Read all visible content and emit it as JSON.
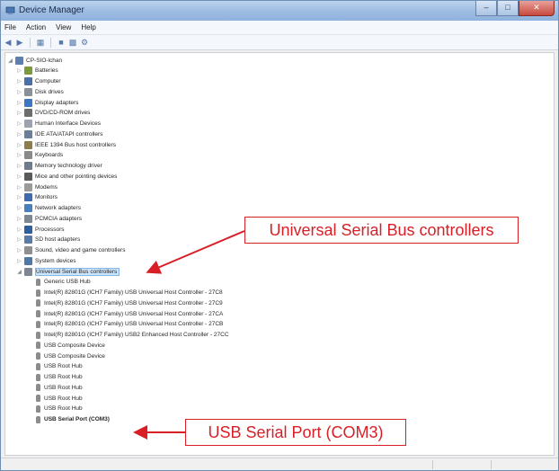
{
  "window": {
    "title": "Device Manager"
  },
  "menu": [
    "File",
    "Action",
    "View",
    "Help"
  ],
  "toolbar_icons": [
    "back-icon",
    "forward-icon",
    "properties-icon",
    "help-icon",
    "update-driver-icon",
    "scan-hardware-icon"
  ],
  "tree": {
    "root": "CP-SIO-lchan",
    "categories": [
      "Batteries",
      "Computer",
      "Disk drives",
      "Display adapters",
      "DVD/CD-ROM drives",
      "Human Interface Devices",
      "IDE ATA/ATAPI controllers",
      "IEEE 1394 Bus host controllers",
      "Keyboards",
      "Memory technology driver",
      "Mice and other pointing devices",
      "Modems",
      "Monitors",
      "Network adapters",
      "PCMCIA adapters",
      "Processors",
      "SD host adapters",
      "Sound, video and game controllers",
      "System devices"
    ],
    "expanded_category": "Universal Serial Bus controllers",
    "usb_children": [
      "Generic USB Hub",
      "Intel(R) 82801G (ICH7 Family) USB Universal Host Controller - 27C8",
      "Intel(R) 82801G (ICH7 Family) USB Universal Host Controller - 27C9",
      "Intel(R) 82801G (ICH7 Family) USB Universal Host Controller - 27CA",
      "Intel(R) 82801G (ICH7 Family) USB Universal Host Controller - 27CB",
      "Intel(R) 82801G (ICH7 Family) USB2 Enhanced Host Controller - 27CC",
      "USB Composite Device",
      "USB Composite Device",
      "USB Root Hub",
      "USB Root Hub",
      "USB Root Hub",
      "USB Root Hub",
      "USB Root Hub",
      "USB Serial Port (COM3)"
    ]
  },
  "callouts": {
    "usb_controllers": "Universal Serial Bus controllers",
    "serial_port": "USB Serial Port (COM3)"
  },
  "colors": {
    "accent": "#d81f26",
    "selection": "#cde5fb",
    "titlebar": "#9fbde3"
  }
}
